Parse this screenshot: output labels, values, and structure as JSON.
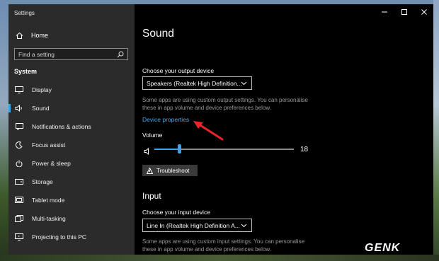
{
  "app": {
    "title": "Settings"
  },
  "sidebar": {
    "home_label": "Home",
    "search_placeholder": "Find a setting",
    "section": "System",
    "items": [
      {
        "label": "Display",
        "icon": "display-icon"
      },
      {
        "label": "Sound",
        "icon": "speaker-icon",
        "active": true
      },
      {
        "label": "Notifications & actions",
        "icon": "notifications-icon"
      },
      {
        "label": "Focus assist",
        "icon": "moon-icon"
      },
      {
        "label": "Power & sleep",
        "icon": "power-icon"
      },
      {
        "label": "Storage",
        "icon": "storage-icon"
      },
      {
        "label": "Tablet mode",
        "icon": "tablet-icon"
      },
      {
        "label": "Multi-tasking",
        "icon": "multitasking-icon"
      },
      {
        "label": "Projecting to this PC",
        "icon": "projector-icon"
      }
    ]
  },
  "window_controls": [
    "minimize",
    "maximize",
    "close"
  ],
  "main": {
    "title": "Sound",
    "output": {
      "label": "Choose your output device",
      "selected": "Speakers (Realtek High Definition...",
      "note": "Some apps are using custom output settings. You can personalise these in app volume and device preferences below.",
      "device_properties_link": "Device properties"
    },
    "volume": {
      "label": "Volume",
      "value": "18",
      "level": 0.18
    },
    "troubleshoot_label": "Troubleshoot",
    "input": {
      "heading": "Input",
      "label": "Choose your input device",
      "selected": "Line In (Realtek High Definition A...",
      "note": "Some apps are using custom input settings. You can personalise these in app volume and device preferences below."
    }
  },
  "annotation": {
    "arrow_color": "#e8262a"
  },
  "colors": {
    "accent": "#3da1e6",
    "link": "#4aa7ee",
    "sidebar": "#2b2b2b",
    "content": "#000000"
  },
  "watermark": "GENK"
}
